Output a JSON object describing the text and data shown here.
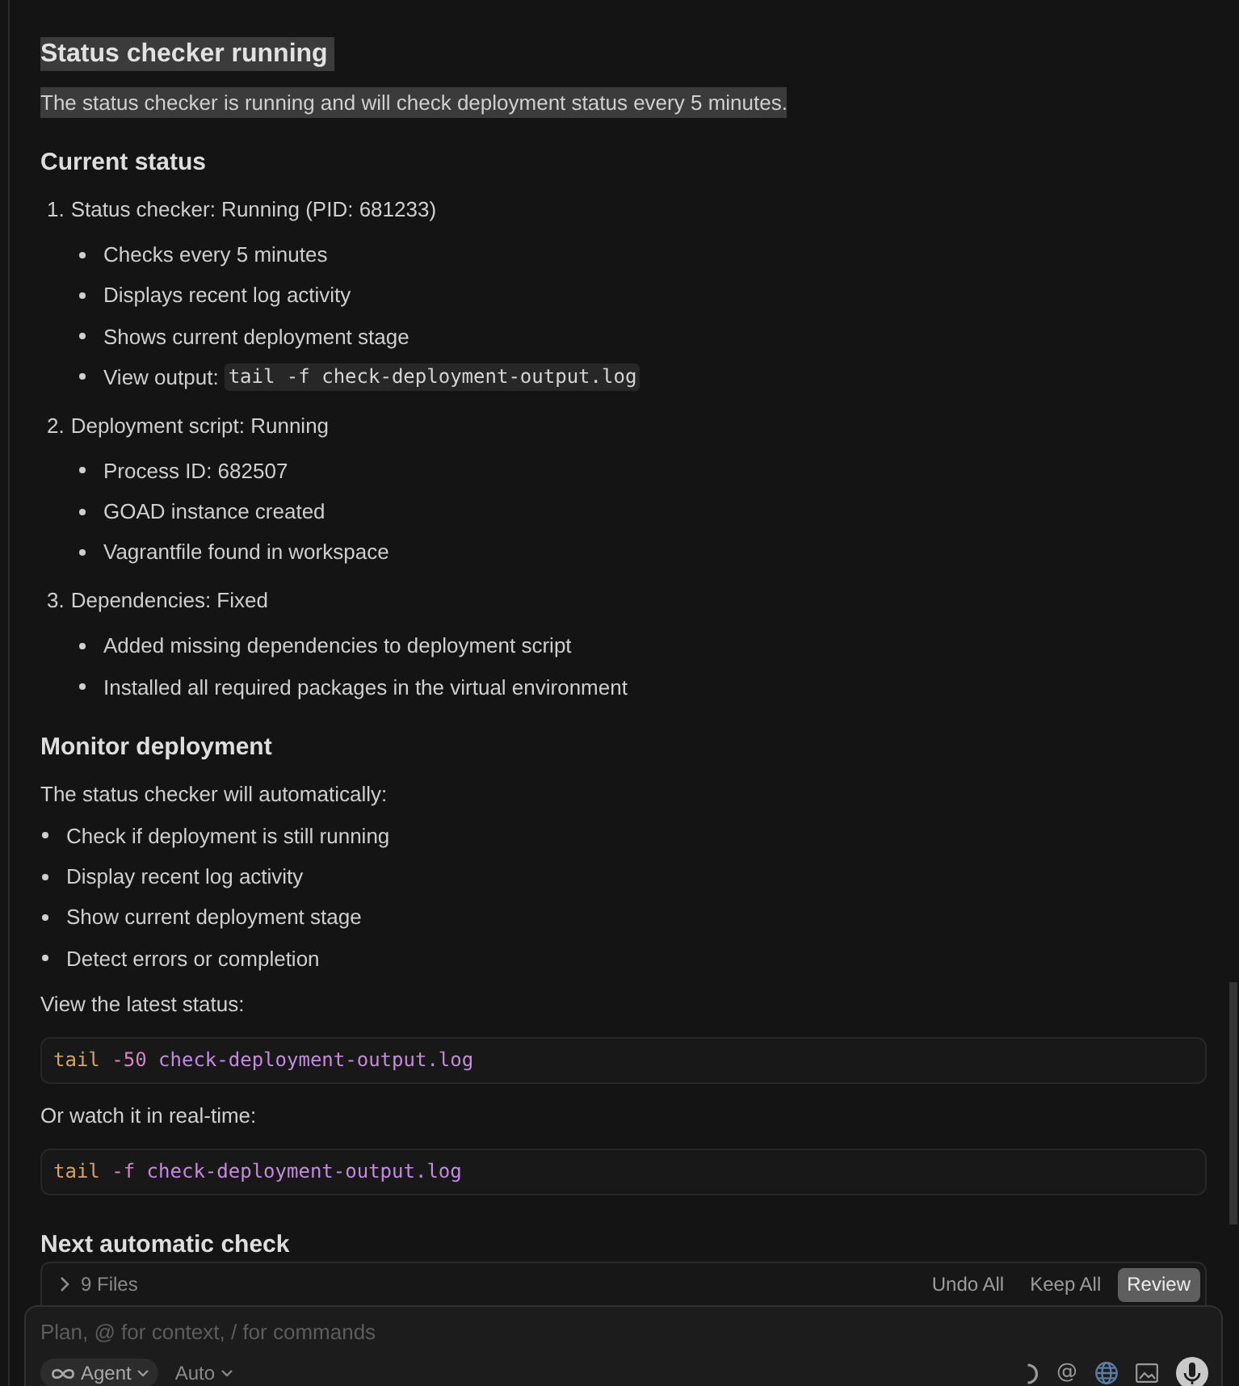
{
  "message": {
    "title": {
      "text": "Status checker running",
      "highlighted": true
    },
    "intro": {
      "text": "The status checker is running and will check deployment status every 5 minutes.",
      "highlighted": true
    },
    "sections": [
      {
        "heading": "Current status",
        "blocks": [
          {
            "kind": "ordered_list",
            "items": [
              {
                "number": "1.",
                "text": "Status checker: Running (PID: 681233)",
                "children": [
                  {
                    "text": "Checks every 5 minutes"
                  },
                  {
                    "text": "Displays recent log activity"
                  },
                  {
                    "text": "Shows current deployment stage"
                  },
                  {
                    "text": "View output:",
                    "code": "tail -f check-deployment-output.log"
                  }
                ]
              },
              {
                "number": "2.",
                "text": "Deployment script: Running",
                "children": [
                  {
                    "text": "Process ID: 682507"
                  },
                  {
                    "text": "GOAD instance created"
                  },
                  {
                    "text": "Vagrantfile found in workspace"
                  }
                ]
              },
              {
                "number": "3.",
                "text": "Dependencies: Fixed",
                "children": [
                  {
                    "text": "Added missing dependencies to deployment script"
                  },
                  {
                    "text": "Installed all required packages in the virtual environment"
                  }
                ]
              }
            ]
          }
        ]
      },
      {
        "heading": "Monitor deployment",
        "blocks": [
          {
            "kind": "paragraph",
            "text": "The status checker will automatically:"
          },
          {
            "kind": "bullet_list",
            "items": [
              {
                "text": "Check if deployment is still running"
              },
              {
                "text": "Display recent log activity"
              },
              {
                "text": "Show current deployment stage"
              },
              {
                "text": "Detect errors or completion"
              }
            ]
          },
          {
            "kind": "paragraph",
            "text": "View the latest status:"
          },
          {
            "kind": "code_block",
            "tokens": [
              {
                "kind": "command",
                "text": "tail"
              },
              {
                "kind": "flag",
                "text": "-50"
              },
              {
                "kind": "argument",
                "text": "check-deployment-output.log"
              }
            ]
          },
          {
            "kind": "paragraph",
            "text": "Or watch it in real-time:"
          },
          {
            "kind": "code_block",
            "tokens": [
              {
                "kind": "command",
                "text": "tail"
              },
              {
                "kind": "flag",
                "text": "-f"
              },
              {
                "kind": "argument",
                "text": "check-deployment-output.log"
              }
            ]
          }
        ]
      },
      {
        "heading": "Next automatic check"
      }
    ]
  },
  "changes_bar": {
    "expanded": false,
    "label": "9 Files",
    "buttons": [
      {
        "label": "Undo All",
        "kind": "plain"
      },
      {
        "label": "Keep All",
        "kind": "plain"
      },
      {
        "label": "Review",
        "kind": "primary"
      }
    ]
  },
  "composer": {
    "placeholder": "Plan, @ for context, / for commands",
    "mode": "Agent",
    "model": "Auto",
    "mention_symbol": "@"
  }
}
